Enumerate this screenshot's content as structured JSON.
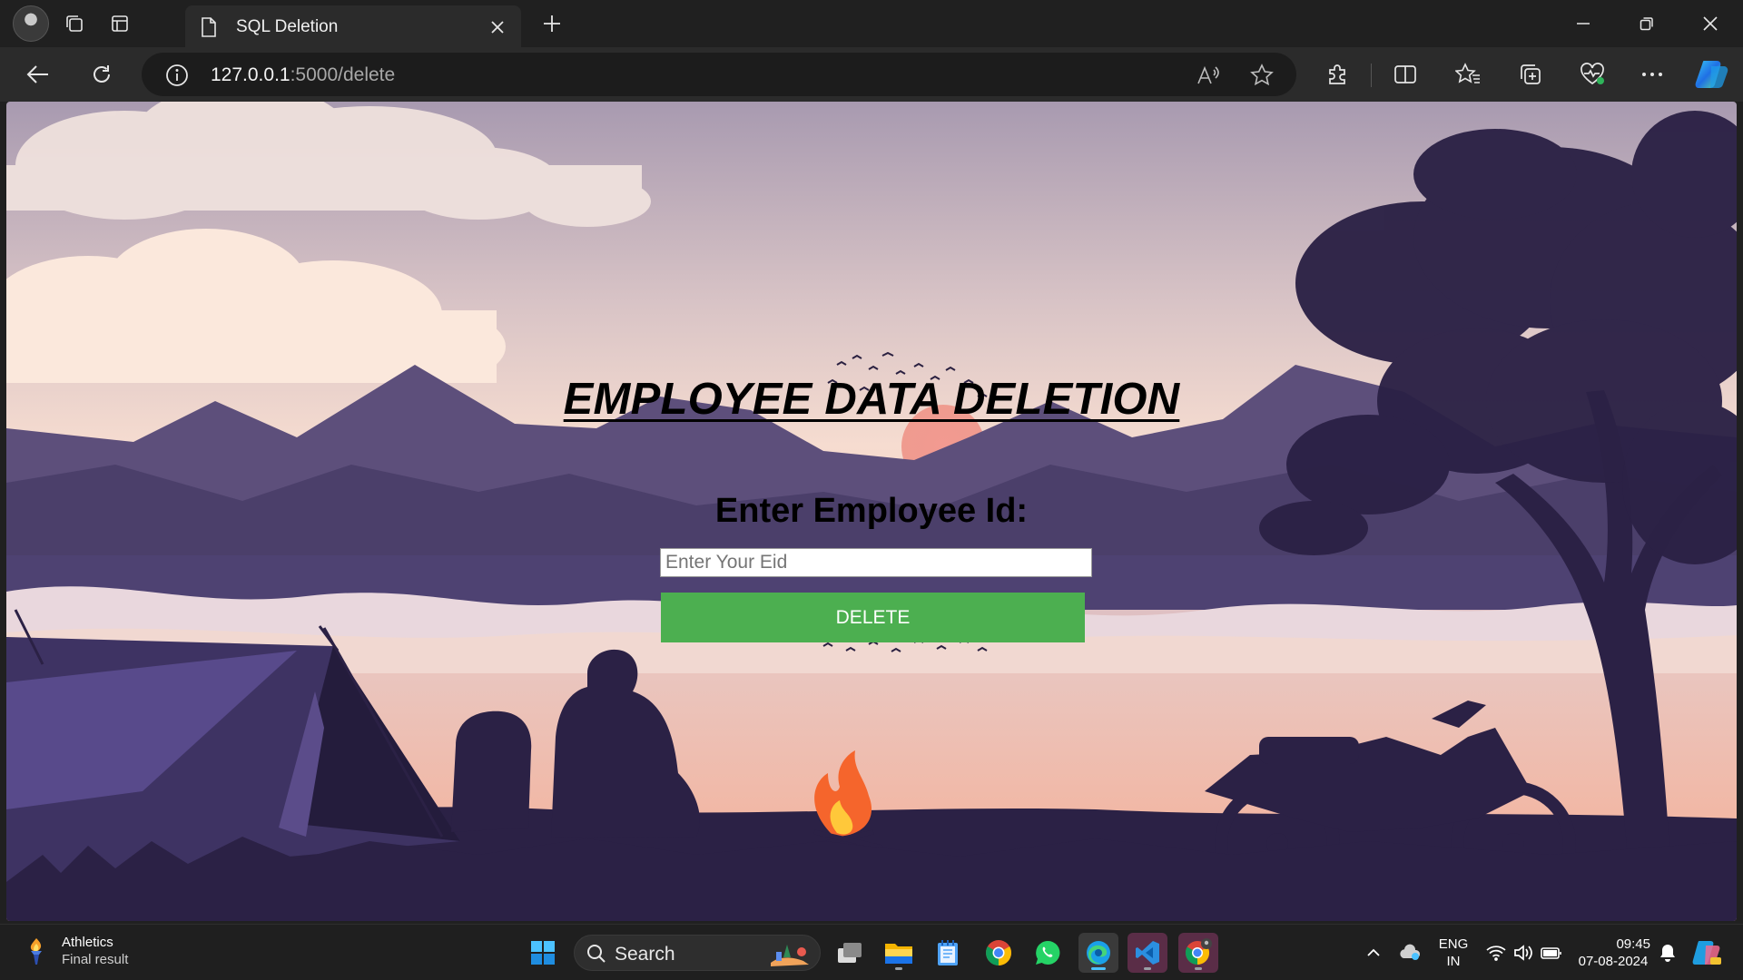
{
  "browser": {
    "tab_title": "SQL Deletion",
    "url_host": "127.0.0.1",
    "url_rest": ":5000/delete",
    "icons": [
      "profile-avatar",
      "workspaces-icon",
      "tab-actions-icon",
      "document-icon",
      "close-icon",
      "new-tab-icon",
      "minimize-icon",
      "restore-icon",
      "window-close-icon",
      "back-icon",
      "refresh-icon",
      "info-icon",
      "read-aloud-icon",
      "favorite-star-icon",
      "extensions-icon",
      "split-screen-icon",
      "favorites-icon",
      "collections-icon",
      "browser-essentials-icon",
      "more-icon",
      "copilot-icon"
    ]
  },
  "page": {
    "heading": "EMPLOYEE DATA DELETION",
    "label": "Enter Employee Id:",
    "input_placeholder": "Enter Your Eid",
    "input_value": "",
    "button_label": "DELETE",
    "button_color": "#4caf50"
  },
  "taskbar": {
    "widget_title": "Athletics",
    "widget_subtitle": "Final result",
    "search_label": "Search",
    "lang_line1": "ENG",
    "lang_line2": "IN",
    "time": "09:45",
    "date": "07-08-2024",
    "apps": [
      "start-icon",
      "task-view-icon",
      "file-explorer-icon",
      "notepad-icon",
      "chrome-icon",
      "whatsapp-icon",
      "edge-icon",
      "vscode-icon",
      "chrome-profile-icon"
    ]
  }
}
